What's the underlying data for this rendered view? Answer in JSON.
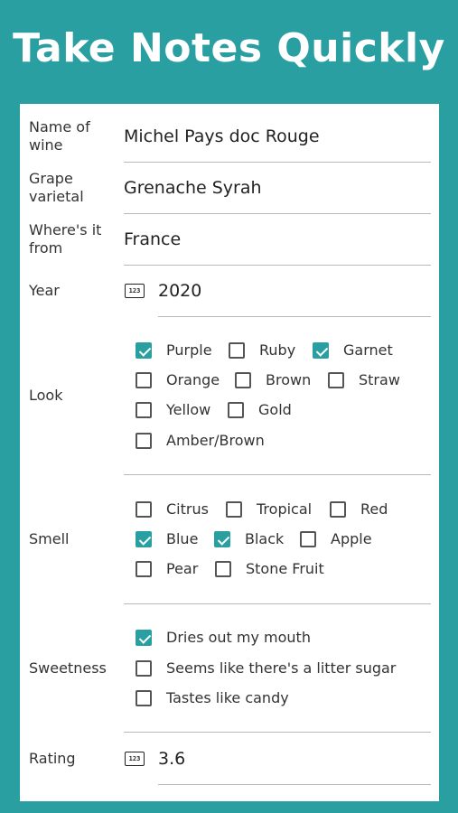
{
  "headline": "Take Notes Quickly",
  "fields": {
    "name": {
      "label": "Name of wine",
      "value": "Michel Pays doc Rouge"
    },
    "grape": {
      "label": "Grape varietal",
      "value": "Grenache Syrah"
    },
    "origin": {
      "label": "Where's it from",
      "value": "France"
    },
    "year": {
      "label": "Year",
      "value": "2020",
      "icon": "numeric-keypad-icon",
      "icon_text": "123"
    },
    "rating": {
      "label": "Rating",
      "value": "3.6",
      "icon": "numeric-keypad-icon",
      "icon_text": "123"
    }
  },
  "look": {
    "label": "Look",
    "options": [
      {
        "label": "Purple",
        "checked": true
      },
      {
        "label": "Ruby",
        "checked": false
      },
      {
        "label": "Garnet",
        "checked": true
      },
      {
        "label": "Orange",
        "checked": false
      },
      {
        "label": "Brown",
        "checked": false
      },
      {
        "label": "Straw",
        "checked": false
      },
      {
        "label": "Yellow",
        "checked": false
      },
      {
        "label": "Gold",
        "checked": false
      },
      {
        "label": "Amber/Brown",
        "checked": false
      }
    ]
  },
  "smell": {
    "label": "Smell",
    "options": [
      {
        "label": "Citrus",
        "checked": false
      },
      {
        "label": "Tropical",
        "checked": false
      },
      {
        "label": "Red",
        "checked": false
      },
      {
        "label": "Blue",
        "checked": true
      },
      {
        "label": "Black",
        "checked": true
      },
      {
        "label": "Apple",
        "checked": false
      },
      {
        "label": "Pear",
        "checked": false
      },
      {
        "label": "Stone Fruit",
        "checked": false
      }
    ]
  },
  "sweetness": {
    "label": "Sweetness",
    "options": [
      {
        "label": "Dries out my mouth",
        "checked": true
      },
      {
        "label": "Seems like there's a litter sugar",
        "checked": false
      },
      {
        "label": "Tastes like candy",
        "checked": false
      }
    ]
  },
  "colors": {
    "accent": "#2a9fa1",
    "card": "#ffffff",
    "text": "#333333"
  }
}
